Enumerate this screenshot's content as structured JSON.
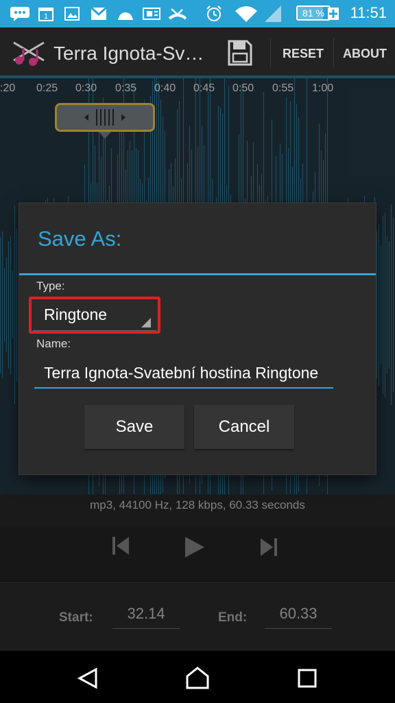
{
  "status_bar": {
    "icons": [
      "chat-icon",
      "calendar-icon",
      "image-icon",
      "gmail-icon",
      "weather-icon",
      "sim-icon",
      "missed-call-icon",
      "alarm-icon",
      "wifi-icon",
      "signal-icon",
      "battery-icon"
    ],
    "calendar_day": "1",
    "battery": "81 %",
    "battery_level": 0.81,
    "time": "11:51",
    "background": "#2aa3d6"
  },
  "app_bar": {
    "title": "Terra Ignota-Sv…",
    "reset": "RESET",
    "about": "ABOUT"
  },
  "timeline": {
    "ticks": [
      ":20",
      "0:25",
      "0:30",
      "0:35",
      "0:40",
      "0:45",
      "0:50",
      "0:55",
      "1:00"
    ]
  },
  "file_info": "mp3, 44100 Hz, 128 kbps, 60.33 seconds",
  "range": {
    "start_label": "Start:",
    "start_value": "32.14",
    "end_label": "End:",
    "end_value": "60.33"
  },
  "dialog": {
    "title": "Save As:",
    "type_label": "Type:",
    "type_value": "Ringtone",
    "name_label": "Name:",
    "name_value": "Terra Ignota-Svatební hostina Ringtone",
    "save": "Save",
    "cancel": "Cancel",
    "accent": "#33a6d6",
    "highlight": "#e02020"
  }
}
